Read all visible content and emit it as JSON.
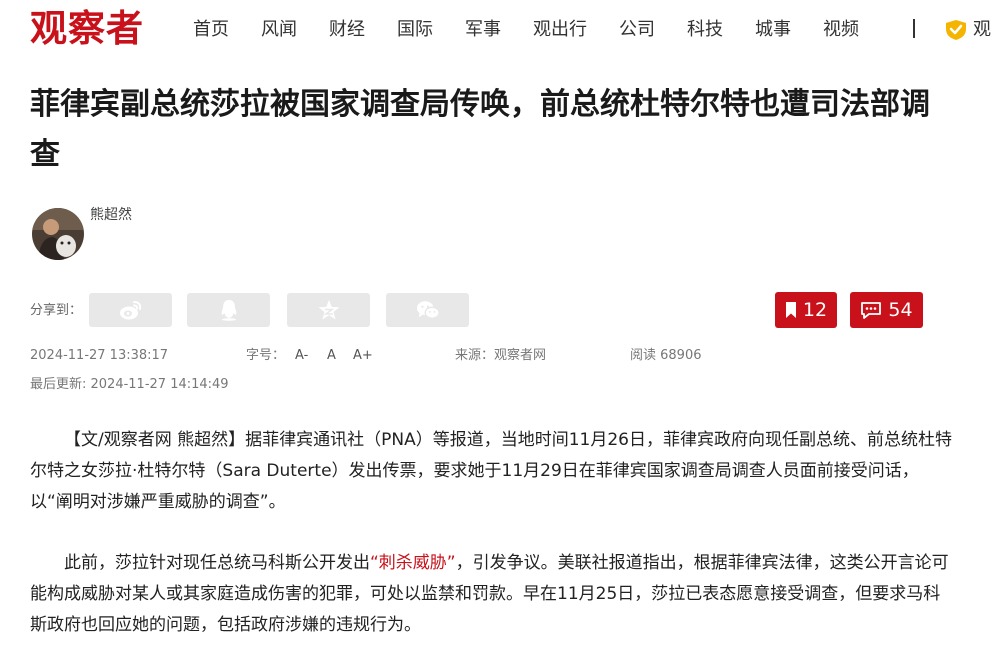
{
  "header": {
    "logo": "观察者",
    "nav": [
      "首页",
      "风闻",
      "财经",
      "国际",
      "军事",
      "观出行",
      "公司",
      "科技",
      "城事",
      "视频"
    ],
    "brand_text": "观"
  },
  "article": {
    "title": "菲律宾副总统莎拉被国家调查局传唤，前总统杜特尔特也遭司法部调查",
    "author": "熊超然",
    "share_label": "分享到：",
    "share_icons": [
      "weibo-icon",
      "qq-icon",
      "qzone-icon",
      "wechat-icon"
    ],
    "bookmark_count": "12",
    "comment_count": "54",
    "publish_time": "2024-11-27 13:38:17",
    "font_size_label": "字号：",
    "font_sizes": [
      "A-",
      "A",
      "A+"
    ],
    "source": "来源：观察者网",
    "views": "阅读 68906",
    "updated": "最后更新: 2024-11-27 14:14:49",
    "paragraph1": "【文/观察者网 熊超然】据菲律宾通讯社（PNA）等报道，当地时间11月26日，菲律宾政府向现任副总统、前总统杜特尔特之女莎拉·杜特尔特（Sara Duterte）发出传票，要求她于11月29日在菲律宾国家调查局调查人员面前接受问话，以“阐明对涉嫌严重威胁的调查”。",
    "paragraph2_before": "此前，莎拉针对现任总统马科斯公开发出",
    "paragraph2_quote": "“刺杀威胁”",
    "paragraph2_after": "，引发争议。美联社报道指出，根据菲律宾法律，这类公开言论可能构成威胁对某人或其家庭造成伤害的犯罪，可处以监禁和罚款。早在11月25日，莎拉已表态愿意接受调查，但要求马科斯政府也回应她的问题，包括政府涉嫌的违规行为。"
  },
  "colors": {
    "brand_red": "#c8111a",
    "share_bg": "#e8e8e8",
    "brand_yellow": "#f5b400"
  }
}
